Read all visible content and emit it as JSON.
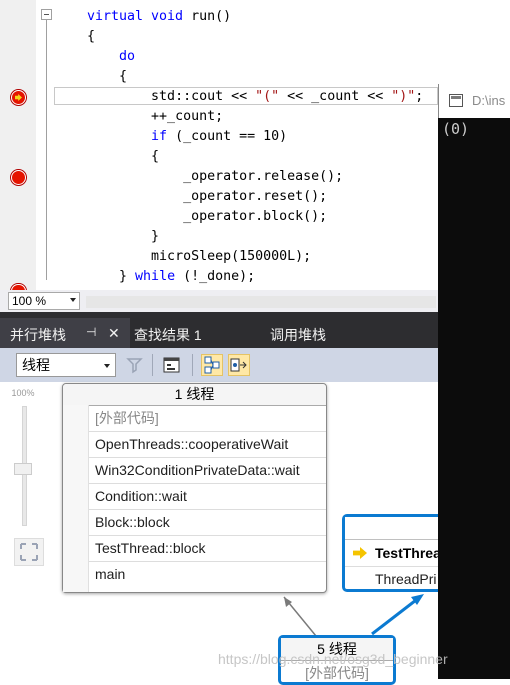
{
  "editor": {
    "lines": [
      {
        "indent": "",
        "parts": [
          {
            "t": "virtual void ",
            "c": "kw"
          },
          {
            "t": "run()",
            "c": ""
          }
        ]
      },
      {
        "indent": "",
        "parts": [
          {
            "t": "{",
            "c": ""
          }
        ]
      },
      {
        "indent": "    ",
        "parts": [
          {
            "t": "do",
            "c": "kw"
          }
        ]
      },
      {
        "indent": "    ",
        "parts": [
          {
            "t": "{",
            "c": ""
          }
        ]
      },
      {
        "indent": "        ",
        "parts": [
          {
            "t": "std::cout << ",
            "c": ""
          },
          {
            "t": "\"(\"",
            "c": "str"
          },
          {
            "t": " << _count << ",
            "c": ""
          },
          {
            "t": "\")\"",
            "c": "str"
          },
          {
            "t": ";",
            "c": ""
          }
        ]
      },
      {
        "indent": "        ",
        "parts": [
          {
            "t": "++_count;",
            "c": ""
          }
        ]
      },
      {
        "indent": "        ",
        "parts": [
          {
            "t": "if",
            "c": "kw"
          },
          {
            "t": " (_count == 10)",
            "c": ""
          }
        ]
      },
      {
        "indent": "        ",
        "parts": [
          {
            "t": "{",
            "c": ""
          }
        ]
      },
      {
        "indent": "            ",
        "parts": [
          {
            "t": "_operator.release();",
            "c": ""
          }
        ]
      },
      {
        "indent": "            ",
        "parts": [
          {
            "t": "_operator.reset();",
            "c": ""
          }
        ]
      },
      {
        "indent": "            ",
        "parts": [
          {
            "t": "_operator.block();",
            "c": ""
          }
        ]
      },
      {
        "indent": "        ",
        "parts": [
          {
            "t": "}",
            "c": ""
          }
        ]
      },
      {
        "indent": "        ",
        "parts": [
          {
            "t": "microSleep(150000L);",
            "c": ""
          }
        ]
      },
      {
        "indent": "    ",
        "parts": [
          {
            "t": "} ",
            "c": ""
          },
          {
            "t": "while",
            "c": "kw"
          },
          {
            "t": " (!_done);",
            "c": ""
          }
        ]
      }
    ],
    "zoom_label": "100 %"
  },
  "console": {
    "title": "D:\\ins",
    "output": "(0)"
  },
  "tool_window": {
    "tabs": [
      {
        "label": "并行堆栈",
        "pin": "⊣",
        "close": "✕"
      },
      {
        "label": "查找结果 1"
      },
      {
        "label": "调用堆栈"
      }
    ],
    "thread_select": "线程",
    "zoom_percent": "100%"
  },
  "nodes": {
    "main": {
      "header": "1 线程",
      "frames": [
        "[外部代码]",
        "OpenThreads::cooperativeWait",
        "Win32ConditionPrivateData::wait",
        "Condition::wait",
        "Block::block",
        "TestThread::block",
        "main"
      ]
    },
    "right": {
      "row1": "TestThrea",
      "row2": "ThreadPri"
    },
    "bottom": {
      "header": "5 线程",
      "row": "[外部代码]"
    }
  },
  "watermark": "https://blog.csdn.net/osg3d_beginner",
  "colors": {
    "keyword": "#0000ff",
    "string": "#a31515",
    "breakpoint": "#e51400",
    "node_active_border": "#0b7ad1",
    "tab_bar": "#2d2d30",
    "console_bg": "#0c0c0c"
  }
}
